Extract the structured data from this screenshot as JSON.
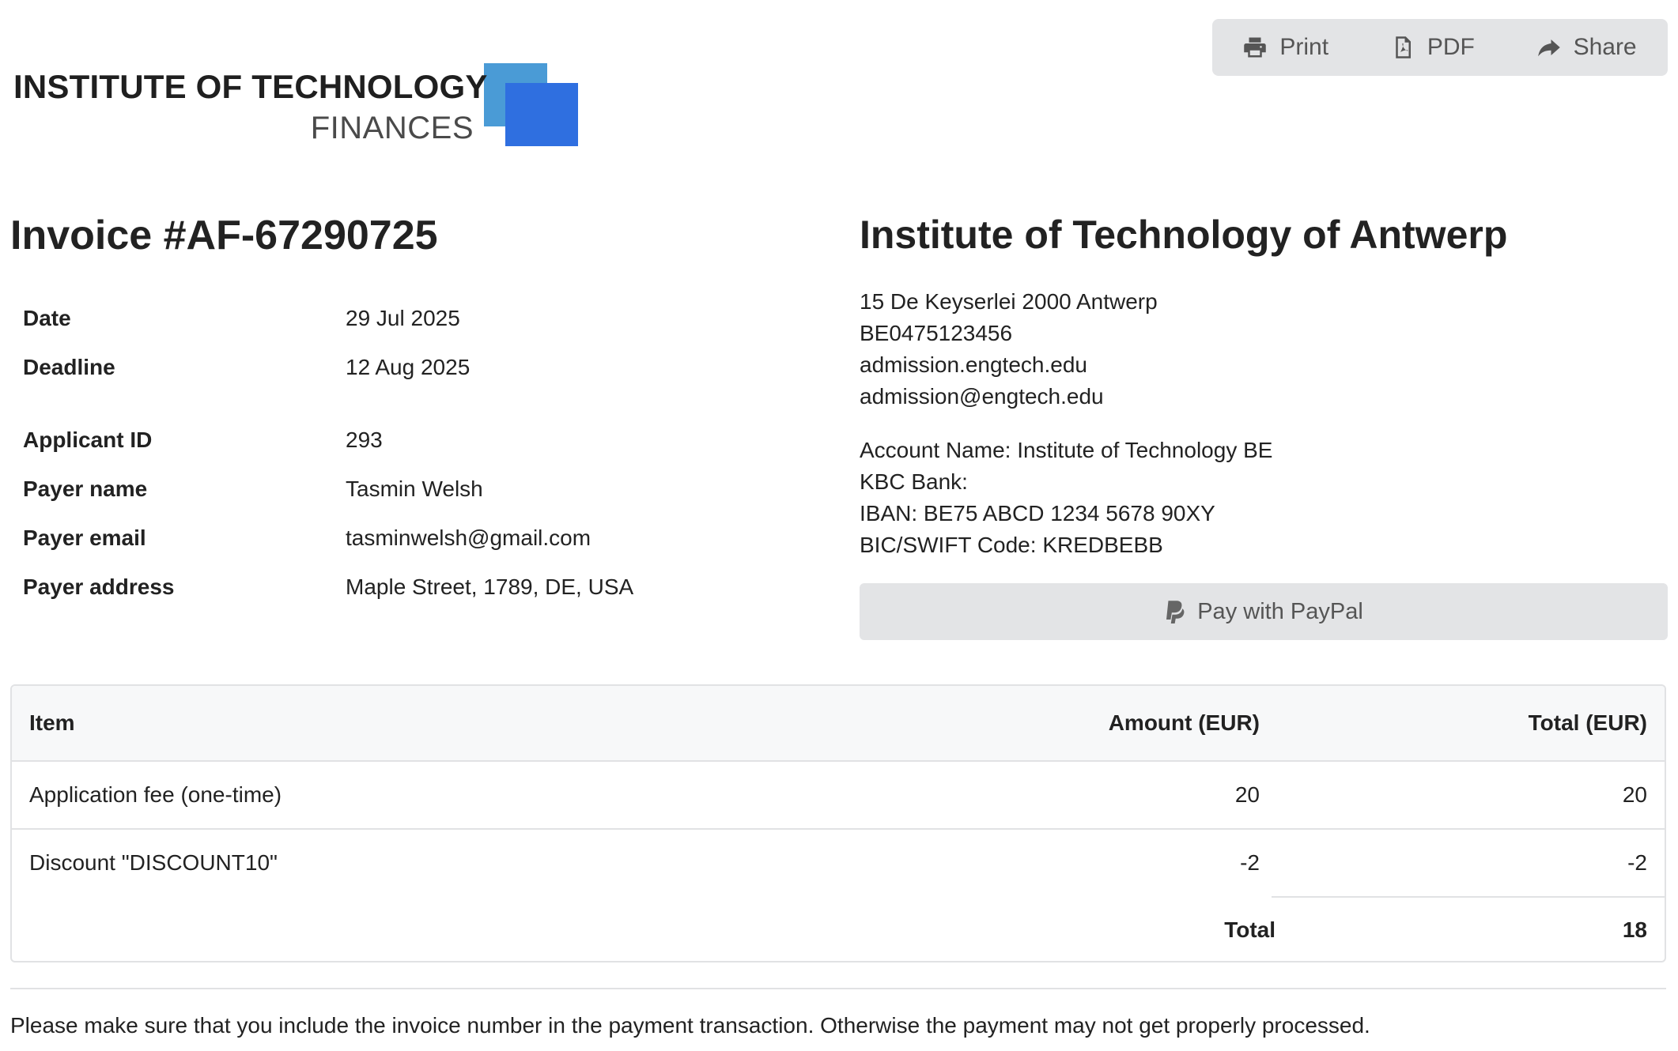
{
  "logo": {
    "line1": "INSTITUTE OF TECHNOLOGY",
    "line2": "FINANCES",
    "colors": {
      "back_square": "#4a9bd6",
      "front_square": "#2f6fe0"
    }
  },
  "toolbar": {
    "print_label": "Print",
    "pdf_label": "PDF",
    "share_label": "Share"
  },
  "invoice": {
    "title": "Invoice #AF-67290725",
    "fields": [
      {
        "label": "Date",
        "value": "29 Jul 2025"
      },
      {
        "label": "Deadline",
        "value": "12 Aug 2025"
      },
      {
        "label": "Applicant ID",
        "value": "293"
      },
      {
        "label": "Payer name",
        "value": "Tasmin Welsh"
      },
      {
        "label": "Payer email",
        "value": "tasminwelsh@gmail.com"
      },
      {
        "label": "Payer address",
        "value": "Maple Street, 1789, DE, USA"
      }
    ]
  },
  "organization": {
    "name": "Institute of Technology of Antwerp",
    "address": "15 De Keyserlei 2000 Antwerp",
    "vat": "BE0475123456",
    "website": "admission.engtech.edu",
    "email": "admission@engtech.edu",
    "bank": {
      "account_name": "Account Name: Institute of Technology BE",
      "bank_name": "KBC Bank:",
      "iban": "IBAN: BE75 ABCD 1234 5678 90XY",
      "bic": "BIC/SWIFT Code: KREDBEBB"
    },
    "paypal_label": "Pay with PayPal"
  },
  "items_table": {
    "headers": {
      "item": "Item",
      "amount": "Amount (EUR)",
      "total": "Total (EUR)"
    },
    "rows": [
      {
        "item": "Application fee (one-time)",
        "amount": "20",
        "total": "20"
      },
      {
        "item": "Discount \"DISCOUNT10\"",
        "amount": "-2",
        "total": "-2"
      }
    ],
    "total_label": "Total",
    "total_value": "18"
  },
  "note": "Please make sure that you include the invoice number in the payment transaction. Otherwise the payment may not get properly processed."
}
